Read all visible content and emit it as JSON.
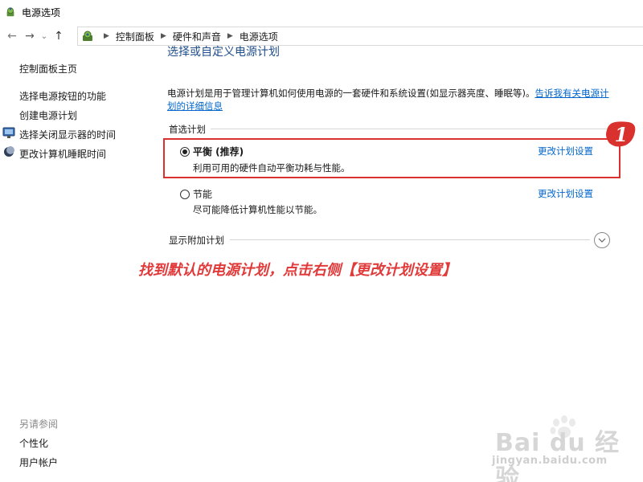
{
  "window": {
    "title": "电源选项"
  },
  "nav": {
    "back": "←",
    "forward": "→",
    "recent": "⌄",
    "up": "↑",
    "breadcrumbs": [
      "控制面板",
      "硬件和声音",
      "电源选项"
    ]
  },
  "sidebar": {
    "home": "控制面板主页",
    "links": [
      "选择电源按钮的功能",
      "创建电源计划",
      "选择关闭显示器的时间",
      "更改计算机睡眠时间"
    ],
    "see_also_heading": "另请参阅",
    "see_also": [
      "个性化",
      "用户帐户"
    ]
  },
  "main": {
    "title": "选择或自定义电源计划",
    "description": "电源计划是用于管理计算机如何使用电源的一套硬件和系统设置(如显示器亮度、睡眠等)。",
    "description_link": "告诉我有关电源计划的详细信息",
    "preferred_heading": "首选计划",
    "plans": [
      {
        "name": "平衡 (推荐)",
        "description": "利用可用的硬件自动平衡功耗与性能。",
        "link": "更改计划设置",
        "selected": true
      },
      {
        "name": "节能",
        "description": "尽可能降低计算机性能以节能。",
        "link": "更改计划设置",
        "selected": false
      }
    ],
    "additional_heading": "显示附加计划"
  },
  "overlay": {
    "badge_number": "1",
    "annotation": "找到默认的电源计划，点击右侧【更改计划设置】"
  },
  "watermark": {
    "brand": "Bai du 经验",
    "url": "jingyan.baidu.com"
  },
  "colors": {
    "accent_link": "#0066cc",
    "title_blue": "#1e4e8c",
    "highlight_red": "#d8312e",
    "annotation_red": "#e03a3a"
  },
  "icons": [
    "power-options-icon",
    "back-arrow-icon",
    "forward-arrow-icon",
    "chevron-down-icon",
    "up-arrow-icon",
    "breadcrumb-separator-icon",
    "display-icon",
    "moon-icon",
    "expand-chevron-icon"
  ]
}
